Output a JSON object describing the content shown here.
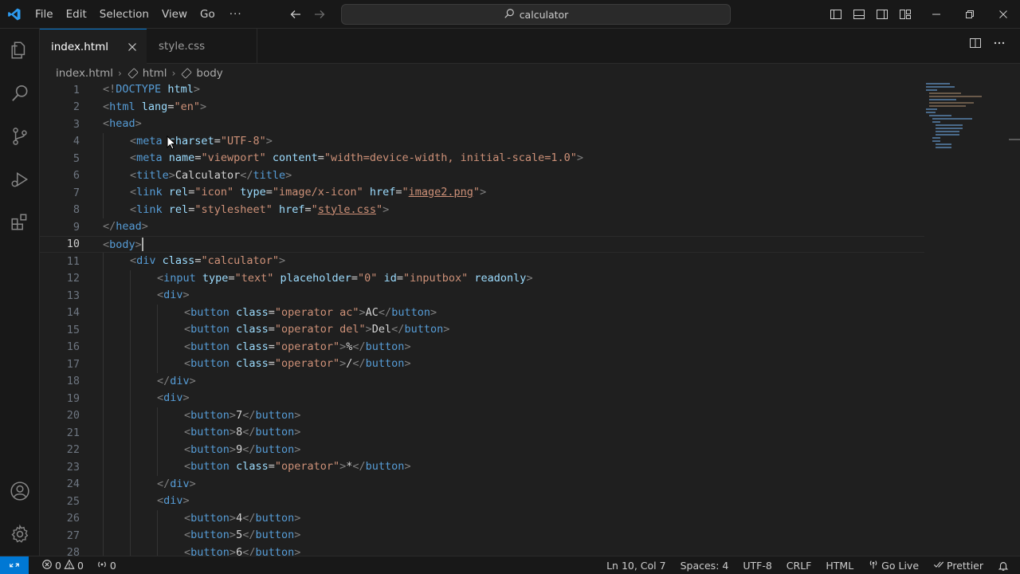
{
  "menu": {
    "items": [
      "File",
      "Edit",
      "Selection",
      "View",
      "Go"
    ],
    "more": "···"
  },
  "command_center": {
    "text": "calculator"
  },
  "tabs": [
    {
      "label": "index.html",
      "active": true
    },
    {
      "label": "style.css",
      "active": false
    }
  ],
  "breadcrumb": {
    "file": "index.html",
    "html": "html",
    "body": "body"
  },
  "editor": {
    "current_line": 10,
    "lines": [
      {
        "n": "1",
        "parts": [
          [
            "p",
            "<!"
          ],
          [
            "t",
            "DOCTYPE"
          ],
          [
            "x",
            " "
          ],
          [
            "a",
            "html"
          ],
          [
            "p",
            ">"
          ]
        ]
      },
      {
        "n": "2",
        "parts": [
          [
            "p",
            "<"
          ],
          [
            "t",
            "html"
          ],
          [
            "x",
            " "
          ],
          [
            "a",
            "lang"
          ],
          [
            "x",
            "="
          ],
          [
            "s",
            "\"en\""
          ],
          [
            "p",
            ">"
          ]
        ]
      },
      {
        "n": "3",
        "parts": [
          [
            "p",
            "<"
          ],
          [
            "t",
            "head"
          ],
          [
            "p",
            ">"
          ]
        ]
      },
      {
        "n": "4",
        "indent": 1,
        "parts": [
          [
            "p",
            "<"
          ],
          [
            "t",
            "meta"
          ],
          [
            "x",
            " "
          ],
          [
            "a",
            "charset"
          ],
          [
            "x",
            "="
          ],
          [
            "s",
            "\"UTF-8\""
          ],
          [
            "p",
            ">"
          ]
        ]
      },
      {
        "n": "5",
        "indent": 1,
        "parts": [
          [
            "p",
            "<"
          ],
          [
            "t",
            "meta"
          ],
          [
            "x",
            " "
          ],
          [
            "a",
            "name"
          ],
          [
            "x",
            "="
          ],
          [
            "s",
            "\"viewport\""
          ],
          [
            "x",
            " "
          ],
          [
            "a",
            "content"
          ],
          [
            "x",
            "="
          ],
          [
            "s",
            "\"width=device-width, initial-scale=1.0\""
          ],
          [
            "p",
            ">"
          ]
        ]
      },
      {
        "n": "6",
        "indent": 1,
        "parts": [
          [
            "p",
            "<"
          ],
          [
            "t",
            "title"
          ],
          [
            "p",
            ">"
          ],
          [
            "x",
            "Calculator"
          ],
          [
            "p",
            "</"
          ],
          [
            "t",
            "title"
          ],
          [
            "p",
            ">"
          ]
        ]
      },
      {
        "n": "7",
        "indent": 1,
        "parts": [
          [
            "p",
            "<"
          ],
          [
            "t",
            "link"
          ],
          [
            "x",
            " "
          ],
          [
            "a",
            "rel"
          ],
          [
            "x",
            "="
          ],
          [
            "s",
            "\"icon\""
          ],
          [
            "x",
            " "
          ],
          [
            "a",
            "type"
          ],
          [
            "x",
            "="
          ],
          [
            "s",
            "\"image/x-icon\""
          ],
          [
            "x",
            " "
          ],
          [
            "a",
            "href"
          ],
          [
            "x",
            "="
          ],
          [
            "s",
            "\""
          ],
          [
            "l",
            "image2.png"
          ],
          [
            "s",
            "\""
          ],
          [
            "p",
            ">"
          ]
        ]
      },
      {
        "n": "8",
        "indent": 1,
        "parts": [
          [
            "p",
            "<"
          ],
          [
            "t",
            "link"
          ],
          [
            "x",
            " "
          ],
          [
            "a",
            "rel"
          ],
          [
            "x",
            "="
          ],
          [
            "s",
            "\"stylesheet\""
          ],
          [
            "x",
            " "
          ],
          [
            "a",
            "href"
          ],
          [
            "x",
            "="
          ],
          [
            "s",
            "\""
          ],
          [
            "l",
            "style.css"
          ],
          [
            "s",
            "\""
          ],
          [
            "p",
            ">"
          ]
        ]
      },
      {
        "n": "9",
        "parts": [
          [
            "p",
            "</"
          ],
          [
            "t",
            "head"
          ],
          [
            "p",
            ">"
          ]
        ]
      },
      {
        "n": "10",
        "parts": [
          [
            "p",
            "<"
          ],
          [
            "t",
            "body"
          ],
          [
            "p",
            ">"
          ]
        ]
      },
      {
        "n": "11",
        "indent": 1,
        "parts": [
          [
            "p",
            "<"
          ],
          [
            "t",
            "div"
          ],
          [
            "x",
            " "
          ],
          [
            "a",
            "class"
          ],
          [
            "x",
            "="
          ],
          [
            "s",
            "\"calculator\""
          ],
          [
            "p",
            ">"
          ]
        ]
      },
      {
        "n": "12",
        "indent": 2,
        "parts": [
          [
            "p",
            "<"
          ],
          [
            "t",
            "input"
          ],
          [
            "x",
            " "
          ],
          [
            "a",
            "type"
          ],
          [
            "x",
            "="
          ],
          [
            "s",
            "\"text\""
          ],
          [
            "x",
            " "
          ],
          [
            "a",
            "placeholder"
          ],
          [
            "x",
            "="
          ],
          [
            "s",
            "\"0\""
          ],
          [
            "x",
            " "
          ],
          [
            "a",
            "id"
          ],
          [
            "x",
            "="
          ],
          [
            "s",
            "\"inputbox\""
          ],
          [
            "x",
            " "
          ],
          [
            "a",
            "readonly"
          ],
          [
            "p",
            ">"
          ]
        ]
      },
      {
        "n": "13",
        "indent": 2,
        "parts": [
          [
            "p",
            "<"
          ],
          [
            "t",
            "div"
          ],
          [
            "p",
            ">"
          ]
        ]
      },
      {
        "n": "14",
        "indent": 3,
        "parts": [
          [
            "p",
            "<"
          ],
          [
            "t",
            "button"
          ],
          [
            "x",
            " "
          ],
          [
            "a",
            "class"
          ],
          [
            "x",
            "="
          ],
          [
            "s",
            "\"operator ac\""
          ],
          [
            "p",
            ">"
          ],
          [
            "x",
            "AC"
          ],
          [
            "p",
            "</"
          ],
          [
            "t",
            "button"
          ],
          [
            "p",
            ">"
          ]
        ]
      },
      {
        "n": "15",
        "indent": 3,
        "parts": [
          [
            "p",
            "<"
          ],
          [
            "t",
            "button"
          ],
          [
            "x",
            " "
          ],
          [
            "a",
            "class"
          ],
          [
            "x",
            "="
          ],
          [
            "s",
            "\"operator del\""
          ],
          [
            "p",
            ">"
          ],
          [
            "x",
            "Del"
          ],
          [
            "p",
            "</"
          ],
          [
            "t",
            "button"
          ],
          [
            "p",
            ">"
          ]
        ]
      },
      {
        "n": "16",
        "indent": 3,
        "parts": [
          [
            "p",
            "<"
          ],
          [
            "t",
            "button"
          ],
          [
            "x",
            " "
          ],
          [
            "a",
            "class"
          ],
          [
            "x",
            "="
          ],
          [
            "s",
            "\"operator\""
          ],
          [
            "p",
            ">"
          ],
          [
            "x",
            "%"
          ],
          [
            "p",
            "</"
          ],
          [
            "t",
            "button"
          ],
          [
            "p",
            ">"
          ]
        ]
      },
      {
        "n": "17",
        "indent": 3,
        "parts": [
          [
            "p",
            "<"
          ],
          [
            "t",
            "button"
          ],
          [
            "x",
            " "
          ],
          [
            "a",
            "class"
          ],
          [
            "x",
            "="
          ],
          [
            "s",
            "\"operator\""
          ],
          [
            "p",
            ">"
          ],
          [
            "x",
            "/"
          ],
          [
            "p",
            "</"
          ],
          [
            "t",
            "button"
          ],
          [
            "p",
            ">"
          ]
        ]
      },
      {
        "n": "18",
        "indent": 2,
        "parts": [
          [
            "p",
            "</"
          ],
          [
            "t",
            "div"
          ],
          [
            "p",
            ">"
          ]
        ]
      },
      {
        "n": "19",
        "indent": 2,
        "parts": [
          [
            "p",
            "<"
          ],
          [
            "t",
            "div"
          ],
          [
            "p",
            ">"
          ]
        ]
      },
      {
        "n": "20",
        "indent": 3,
        "parts": [
          [
            "p",
            "<"
          ],
          [
            "t",
            "button"
          ],
          [
            "p",
            ">"
          ],
          [
            "x",
            "7"
          ],
          [
            "p",
            "</"
          ],
          [
            "t",
            "button"
          ],
          [
            "p",
            ">"
          ]
        ]
      },
      {
        "n": "21",
        "indent": 3,
        "parts": [
          [
            "p",
            "<"
          ],
          [
            "t",
            "button"
          ],
          [
            "p",
            ">"
          ],
          [
            "x",
            "8"
          ],
          [
            "p",
            "</"
          ],
          [
            "t",
            "button"
          ],
          [
            "p",
            ">"
          ]
        ]
      },
      {
        "n": "22",
        "indent": 3,
        "parts": [
          [
            "p",
            "<"
          ],
          [
            "t",
            "button"
          ],
          [
            "p",
            ">"
          ],
          [
            "x",
            "9"
          ],
          [
            "p",
            "</"
          ],
          [
            "t",
            "button"
          ],
          [
            "p",
            ">"
          ]
        ]
      },
      {
        "n": "23",
        "indent": 3,
        "parts": [
          [
            "p",
            "<"
          ],
          [
            "t",
            "button"
          ],
          [
            "x",
            " "
          ],
          [
            "a",
            "class"
          ],
          [
            "x",
            "="
          ],
          [
            "s",
            "\"operator\""
          ],
          [
            "p",
            ">"
          ],
          [
            "x",
            "*"
          ],
          [
            "p",
            "</"
          ],
          [
            "t",
            "button"
          ],
          [
            "p",
            ">"
          ]
        ]
      },
      {
        "n": "24",
        "indent": 2,
        "parts": [
          [
            "p",
            "</"
          ],
          [
            "t",
            "div"
          ],
          [
            "p",
            ">"
          ]
        ]
      },
      {
        "n": "25",
        "indent": 2,
        "parts": [
          [
            "p",
            "<"
          ],
          [
            "t",
            "div"
          ],
          [
            "p",
            ">"
          ]
        ]
      },
      {
        "n": "26",
        "indent": 3,
        "parts": [
          [
            "p",
            "<"
          ],
          [
            "t",
            "button"
          ],
          [
            "p",
            ">"
          ],
          [
            "x",
            "4"
          ],
          [
            "p",
            "</"
          ],
          [
            "t",
            "button"
          ],
          [
            "p",
            ">"
          ]
        ]
      },
      {
        "n": "27",
        "indent": 3,
        "parts": [
          [
            "p",
            "<"
          ],
          [
            "t",
            "button"
          ],
          [
            "p",
            ">"
          ],
          [
            "x",
            "5"
          ],
          [
            "p",
            "</"
          ],
          [
            "t",
            "button"
          ],
          [
            "p",
            ">"
          ]
        ]
      },
      {
        "n": "28",
        "indent": 3,
        "parts": [
          [
            "p",
            "<"
          ],
          [
            "t",
            "button"
          ],
          [
            "p",
            ">"
          ],
          [
            "x",
            "6"
          ],
          [
            "p",
            "</"
          ],
          [
            "t",
            "button"
          ],
          [
            "p",
            ">"
          ]
        ]
      }
    ]
  },
  "status": {
    "errors": "0",
    "warnings": "0",
    "ports": "0",
    "position": "Ln 10, Col 7",
    "spaces": "Spaces: 4",
    "encoding": "UTF-8",
    "eol": "CRLF",
    "language": "HTML",
    "golive": "Go Live",
    "prettier": "Prettier"
  },
  "colors": {
    "accent": "#0078d4",
    "tag": "#569cd6",
    "attr": "#9cdcfe",
    "string": "#ce9178"
  }
}
